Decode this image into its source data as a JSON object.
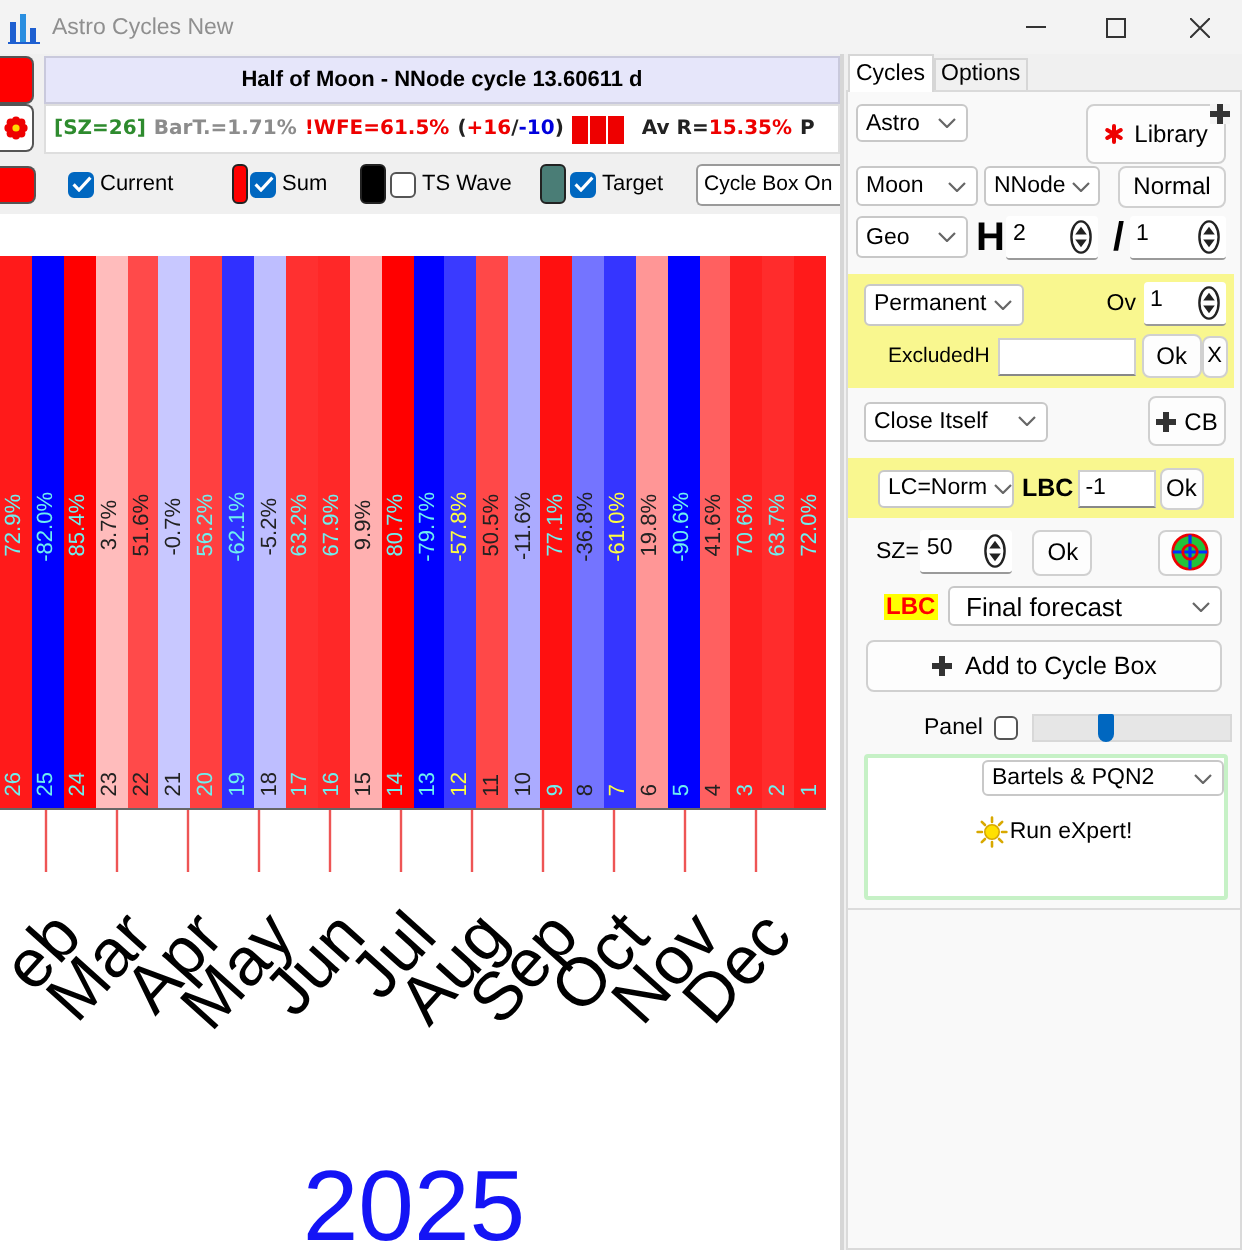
{
  "window": {
    "title": "Astro Cycles New"
  },
  "header": {
    "title": "Half of Moon - NNode cycle 13.60611 d",
    "stats": [
      {
        "kind": "text",
        "parts": [
          {
            "text": "[SZ=26]",
            "color": "#2e8b2e"
          }
        ]
      },
      {
        "kind": "text",
        "parts": [
          {
            "text": "BarT.=1.71%",
            "color": "#8c8c8c"
          }
        ]
      },
      {
        "kind": "text",
        "parts": [
          {
            "text": "!WFE=61.5%",
            "color": "#ee0000"
          }
        ]
      },
      {
        "kind": "text",
        "parts": [
          {
            "text": "(",
            "color": "#222222"
          },
          {
            "text": "+16",
            "color": "#ee0000"
          },
          {
            "text": "/",
            "color": "#222222"
          },
          {
            "text": "-10",
            "color": "#0000dd"
          },
          {
            "text": ")",
            "color": "#222222"
          }
        ]
      },
      {
        "kind": "blocks",
        "blocks": [
          {
            "color": "#ee0000"
          },
          {
            "color": "#ee0000"
          },
          {
            "color": "#ee0000"
          }
        ]
      },
      {
        "kind": "text",
        "parts": [
          {
            "text": "Av R=",
            "color": "#222222"
          },
          {
            "text": "15.35%",
            "color": "#ee0000"
          }
        ]
      },
      {
        "kind": "text",
        "parts": [
          {
            "text": "P",
            "color": "#222222"
          }
        ]
      }
    ]
  },
  "toolbar": {
    "toggles": [
      {
        "label": "Current",
        "checked": true
      },
      {
        "label": "Sum",
        "checked": true,
        "color": "#ff0000"
      },
      {
        "label": "TS Wave",
        "checked": false,
        "color": "#000000"
      },
      {
        "label": "Target",
        "checked": true,
        "color": "#4a7d76"
      }
    ],
    "cycle_box_button": "Cycle Box On"
  },
  "chart": {
    "bars": [
      {
        "number": "26",
        "value": "72.9%",
        "color": "#ff1a1a"
      },
      {
        "number": "25",
        "value": "-82.0%",
        "color": "#0000ff"
      },
      {
        "number": "24",
        "value": "85.4%",
        "color": "#ff0000"
      },
      {
        "number": "23",
        "value": "3.7%",
        "color": "#ffbcbc"
      },
      {
        "number": "22",
        "value": "51.6%",
        "color": "#ff4a4a"
      },
      {
        "number": "21",
        "value": "-0.7%",
        "color": "#c8c8ff"
      },
      {
        "number": "20",
        "value": "56.2%",
        "color": "#ff4040"
      },
      {
        "number": "19",
        "value": "-62.1%",
        "color": "#3030ff"
      },
      {
        "number": "18",
        "value": "-5.2%",
        "color": "#bebeff"
      },
      {
        "number": "17",
        "value": "63.2%",
        "color": "#ff3030"
      },
      {
        "number": "16",
        "value": "67.9%",
        "color": "#ff2828"
      },
      {
        "number": "15",
        "value": "9.9%",
        "color": "#ffb0b0"
      },
      {
        "number": "14",
        "value": "80.7%",
        "color": "#ff0000"
      },
      {
        "number": "13",
        "value": "-79.7%",
        "color": "#0000ff"
      },
      {
        "number": "12",
        "value": "-57.8%",
        "color": "#3a3aff"
      },
      {
        "number": "11",
        "value": "50.5%",
        "color": "#ff4848"
      },
      {
        "number": "10",
        "value": "-11.6%",
        "color": "#ababff"
      },
      {
        "number": "9",
        "value": "77.1%",
        "color": "#ff1010"
      },
      {
        "number": "8",
        "value": "-36.8%",
        "color": "#7474ff"
      },
      {
        "number": "7",
        "value": "-61.0%",
        "color": "#3535ff"
      },
      {
        "number": "6",
        "value": "19.8%",
        "color": "#ff9696"
      },
      {
        "number": "5",
        "value": "-90.6%",
        "color": "#0000ff"
      },
      {
        "number": "4",
        "value": "41.6%",
        "color": "#ff6060"
      },
      {
        "number": "3",
        "value": "70.6%",
        "color": "#ff2020"
      },
      {
        "number": "2",
        "value": "63.7%",
        "color": "#ff2c2c"
      },
      {
        "number": "1",
        "value": "72.0%",
        "color": "#ff1a1a"
      }
    ],
    "months": [
      "eb",
      "Mar",
      "Apr",
      "May",
      "Jun",
      "Jul",
      "Aug",
      "Sep",
      "Oct",
      "Nov",
      "Dec"
    ],
    "year": "2025"
  },
  "side_panel": {
    "tabs": [
      {
        "label": "Cycles",
        "selected": true
      },
      {
        "label": "Options",
        "selected": false
      }
    ],
    "source": "Astro",
    "library_button": "Library",
    "planet": "Moon",
    "node": "NNode",
    "mode_button": "Normal",
    "frame": "Geo",
    "harmonic_label": "H",
    "harmonic": "2",
    "ratio_sign": "/",
    "divisor": "1",
    "exclusion": {
      "mode": "Permanent",
      "ov_label": "Ov",
      "ov": "1",
      "excluded_label": "ExcludedH",
      "ok_button": "Ok",
      "clear_button": "X"
    },
    "close_mode": "Close Itself",
    "cb_button": "CB",
    "lbc": {
      "mode": "LC=Norm",
      "label": "LBC",
      "value": "-1",
      "ok_button": "Ok"
    },
    "size_label": "SZ=",
    "size": "50",
    "size_ok_button": "Ok",
    "forecast_label": "LBC",
    "forecast": "Final forecast",
    "add_button": "Add to Cycle Box",
    "panel_toggle": {
      "label": "Panel",
      "checked": false,
      "level": 0.35
    },
    "expert": {
      "method": "Bartels & PQN2",
      "run_button": "Run eXpert!"
    }
  }
}
